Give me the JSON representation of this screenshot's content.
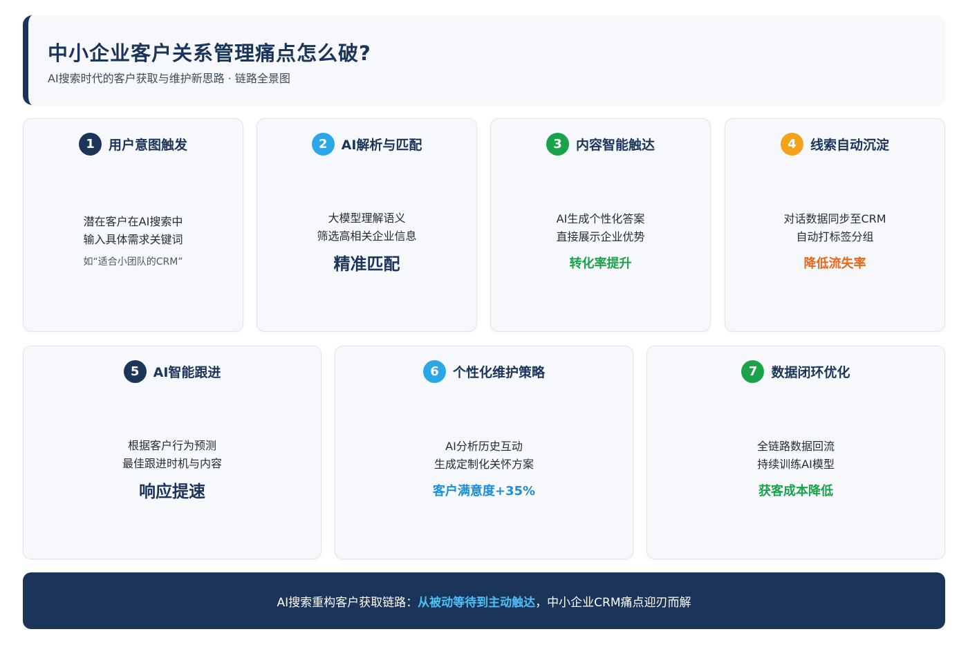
{
  "header": {
    "title": "中小企业客户关系管理痛点怎么破?",
    "subtitle": "AI搜索时代的客户获取与维护新思路 · 链路全景图"
  },
  "colors": {
    "navy": "#1b355a",
    "blue": "#29a7e6",
    "green": "#1aa34a",
    "orange": "#f5a21b",
    "highlight_green": "#1aa34a",
    "highlight_orange": "#e8661a",
    "highlight_blue": "#1b8fd6"
  },
  "cards": [
    {
      "num": "1",
      "title": "用户意图触发",
      "line1": "潜在客户在AI搜索中",
      "line2": "输入具体需求关键词",
      "note": "如“适合小团队的CRM”"
    },
    {
      "num": "2",
      "title": "AI解析与匹配",
      "line1": "大模型理解语义",
      "line2": "筛选高相关企业信息",
      "highlight": "精准匹配"
    },
    {
      "num": "3",
      "title": "内容智能触达",
      "line1": "AI生成个性化答案",
      "line2": "直接展示企业优势",
      "highlight": "转化率提升"
    },
    {
      "num": "4",
      "title": "线索自动沉淀",
      "line1": "对话数据同步至CRM",
      "line2": "自动打标签分组",
      "highlight": "降低流失率"
    },
    {
      "num": "5",
      "title": "AI智能跟进",
      "line1": "根据客户行为预测",
      "line2": "最佳跟进时机与内容",
      "highlight": "响应提速"
    },
    {
      "num": "6",
      "title": "个性化维护策略",
      "line1": "AI分析历史互动",
      "line2": "生成定制化关怀方案",
      "highlight": "客户满意度+35%"
    },
    {
      "num": "7",
      "title": "数据闭环优化",
      "line1": "全链路数据回流",
      "line2": "持续训练AI模型",
      "highlight": "获客成本降低"
    }
  ],
  "footer": {
    "prefix": "AI搜索重构客户获取链路：",
    "emphasis": "从被动等待到主动触达",
    "suffix": "，中小企业CRM痛点迎刃而解"
  }
}
